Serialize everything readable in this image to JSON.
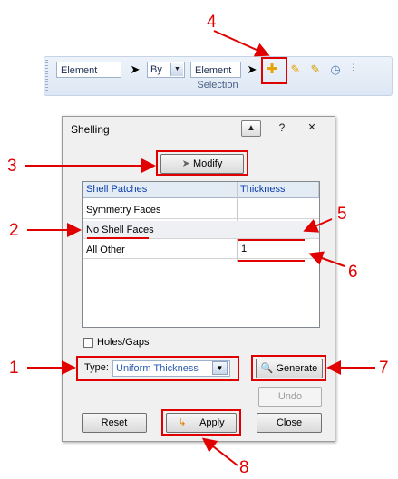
{
  "ribbon": {
    "field1": "Element",
    "combo_value": "By",
    "field2": "Element",
    "group_label": "Selection",
    "icons": [
      "cursor-icon",
      "cursor-icon",
      "shelling-tool-icon",
      "auto-id-icon",
      "auto-id-icon",
      "clock-icon",
      "overflow-icon"
    ]
  },
  "dialog": {
    "title": "Shelling",
    "help_glyph": "?",
    "close_glyph": "✕",
    "modify_label": "Modify",
    "table": {
      "col1": "Shell Patches",
      "col2": "Thickness",
      "rows": [
        {
          "patch": "Symmetry Faces",
          "thickness": ""
        },
        {
          "patch": "No Shell Faces",
          "thickness": ""
        },
        {
          "patch": "All Other",
          "thickness": "1"
        }
      ]
    },
    "holes_label": "Holes/Gaps",
    "type_label": "Type:",
    "type_value": "Uniform Thickness",
    "generate_label": "Generate",
    "undo_label": "Undo",
    "reset_label": "Reset",
    "apply_label": "Apply",
    "close_label": "Close"
  },
  "annotations": [
    "1",
    "2",
    "3",
    "4",
    "5",
    "6",
    "7",
    "8"
  ],
  "colors": {
    "annotation": "#e00000",
    "header_text": "#0b3fa8",
    "type_text": "#2a5bb0"
  }
}
